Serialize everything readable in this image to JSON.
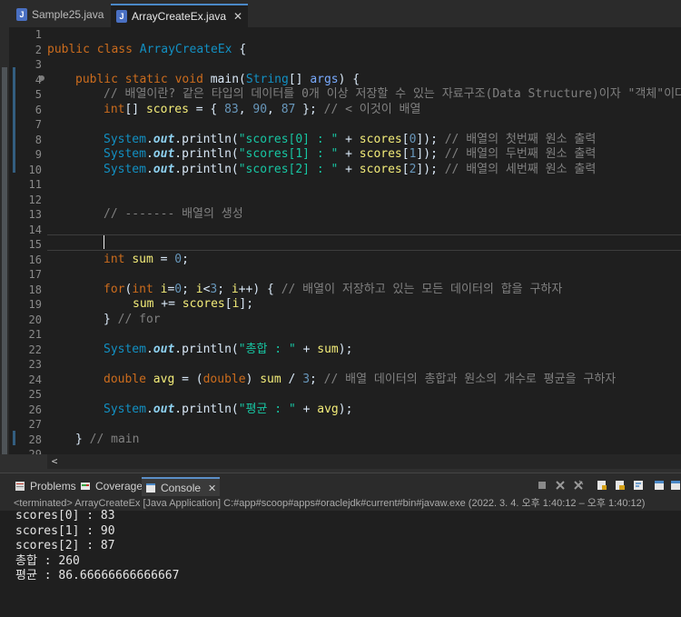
{
  "tabs": [
    {
      "label": "Sample25.java",
      "active": false
    },
    {
      "label": "ArrayCreateEx.java",
      "active": true,
      "close": "✕"
    }
  ],
  "line_numbers": [
    "1",
    "2",
    "3",
    "4",
    "5",
    "6",
    "7",
    "8",
    "9",
    "10",
    "11",
    "12",
    "13",
    "14",
    "15",
    "16",
    "17",
    "18",
    "19",
    "20",
    "21",
    "22",
    "23",
    "24",
    "25",
    "26",
    "27",
    "28",
    "29"
  ],
  "code": {
    "l2": {
      "kw1": "public",
      "kw2": "class",
      "name": "ArrayCreateEx",
      "rest": " {"
    },
    "l4": {
      "kw1": "public",
      "kw2": "static",
      "kw3": "void",
      "name": "main",
      "p1": "(",
      "type": "String",
      "arr": "[] ",
      "param": "args",
      "p2": ") {"
    },
    "l5": {
      "comment": "// 배열이란? 같은 타입의 데이터를 0개 이상 저장할 수 있는 자료구조(Data Structure)이자 \"객체\"이다."
    },
    "l6": {
      "kw": "int",
      "t1": "[] ",
      "var": "scores",
      "t2": " = { ",
      "n1": "83",
      "c1": ", ",
      "n2": "90",
      "c2": ", ",
      "n3": "87",
      "t3": " }; ",
      "comment": "// < 이것이 배열"
    },
    "l8": {
      "cls": "System",
      "dot1": ".",
      "fld": "out",
      "dot2": ".println(",
      "str": "\"scores[0] : \"",
      "plus": " + ",
      "var": "scores",
      "idx1": "[",
      "num": "0",
      "idx2": "]); ",
      "comment": "// 배열의 첫번째 원소 출력"
    },
    "l9": {
      "cls": "System",
      "dot1": ".",
      "fld": "out",
      "dot2": ".println(",
      "str": "\"scores[1] : \"",
      "plus": " + ",
      "var": "scores",
      "idx1": "[",
      "num": "1",
      "idx2": "]); ",
      "comment": "// 배열의 두번째 원소 출력"
    },
    "l10": {
      "cls": "System",
      "dot1": ".",
      "fld": "out",
      "dot2": ".println(",
      "str": "\"scores[2] : \"",
      "plus": " + ",
      "var": "scores",
      "idx1": "[",
      "num": "2",
      "idx2": "]); ",
      "comment": "// 배열의 세번째 원소 출력"
    },
    "l13": {
      "comment": "// ------- 배열의 생성"
    },
    "l16": {
      "kw": "int",
      "var": "sum",
      "t1": " = ",
      "num": "0",
      "t2": ";"
    },
    "l18": {
      "kw1": "for",
      "t1": "(",
      "kw2": "int",
      "v1": "i",
      "t2": "=",
      "n1": "0",
      "t3": "; ",
      "v2": "i",
      "t4": "<",
      "n2": "3",
      "t5": "; ",
      "v3": "i",
      "t6": "++) { ",
      "comment": "// 배열이 저장하고 있는 모든 데이터의 합을 구하자"
    },
    "l19": {
      "v1": "sum",
      "t1": " += ",
      "v2": "scores",
      "t2": "[",
      "v3": "i",
      "t3": "];"
    },
    "l20": {
      "t": "} ",
      "comment": "// for"
    },
    "l22": {
      "cls": "System",
      "dot1": ".",
      "fld": "out",
      "dot2": ".println(",
      "str": "\"총합 : \"",
      "plus": " + ",
      "var": "sum",
      "end": ");"
    },
    "l24": {
      "kw": "double",
      "v1": "avg",
      "t1": " = (",
      "kw2": "double",
      "t2": ") ",
      "v2": "sum",
      "t3": " / ",
      "num": "3",
      "t4": "; ",
      "comment": "// 배열 데이터의 총합과 원소의 개수로 평균을 구하자"
    },
    "l26": {
      "cls": "System",
      "dot1": ".",
      "fld": "out",
      "dot2": ".println(",
      "str": "\"평균 : \"",
      "plus": " + ",
      "var": "avg",
      "end": ");"
    },
    "l28": {
      "t": "} ",
      "comment": "// main"
    }
  },
  "scroll_arrow": "<",
  "console_tabs": [
    {
      "label": "Problems",
      "icon": "problems-icon"
    },
    {
      "label": "Coverage",
      "icon": "coverage-icon"
    },
    {
      "label": "Console",
      "icon": "console-icon",
      "active": true,
      "close": "✕"
    }
  ],
  "status": "<terminated> ArrayCreateEx [Java Application] C:#app#scoop#apps#oraclejdk#current#bin#javaw.exe  (2022. 3. 4. 오후 1:40:12 – 오후 1:40:12)",
  "output": [
    "scores[0] : 83",
    "scores[1] : 90",
    "scores[2] : 87",
    "총합 : 260",
    "평균 : 86.66666666666667"
  ]
}
